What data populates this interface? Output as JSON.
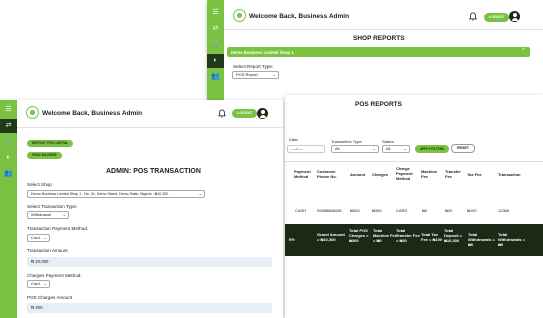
{
  "back_window": {
    "header": {
      "welcome": "Welcome Back, Business Admin",
      "logout": "LOGOUT"
    },
    "page_title": "SHOP REPORTS",
    "accordion": {
      "label": "Demo Business Limited Shop 1",
      "chevron": "^"
    },
    "report_type": {
      "label": "Select Report Type:",
      "value": "POS Report"
    },
    "pos_title": "POS REPORTS",
    "filters": {
      "date_label": "Date:",
      "date_value": "----/----",
      "tx_type_label": "Transaction Type:",
      "tx_type_value": "All",
      "status_label": "Status:",
      "status_value": "All",
      "apply_label": "APPLY FILTERS",
      "reset_label": "RESET"
    },
    "table": {
      "columns": [
        "Payment Method",
        "Customer Phone No.",
        "Amount",
        "Charges",
        "Charge Payment Method",
        "Machine Fee",
        "Transfer Fee",
        "Tax Fee",
        "Transaction"
      ],
      "row": [
        "CASH",
        "09958888438",
        "₦300",
        "₦300",
        "CARD",
        "₦0",
        "₦20",
        "₦100",
        "12366"
      ],
      "footer": [
        "RY:",
        "Grand Amount = ₦10,300",
        "Total POS Charges = ₦300",
        "Total Machine Fee = ₦0",
        "Total Transfer Fee = ₦20",
        "Total Tax Fee = ₦100",
        "Total Deposit = ₦10,300",
        "Total Withdrawals = ₦0",
        "Total Withdrawals = ₦0"
      ]
    }
  },
  "front_window": {
    "header": {
      "welcome": "Welcome Back, Business Admin",
      "logout": "LOGOUT"
    },
    "buttons": {
      "deposit": "DEPOSIT POS CAPITAL",
      "fund": "FUND MACHINE"
    },
    "page_title": "ADMIN: POS TRANSACTION",
    "select_shop": {
      "label": "Select Shop",
      "value": "Demo Business Limited Shop 1 - No. 01, Demo Street, Demo State, Nigeria - ₦10,300"
    },
    "tx_type": {
      "label": "Select Transaction Type:",
      "value": "Withdrawal"
    },
    "payment_method": {
      "label": "Transaction Payment Method:",
      "value": "Card"
    },
    "amount": {
      "label": "Transaction Amount",
      "value": "₦ 10,000"
    },
    "charges_method": {
      "label": "Charges Payment Method:",
      "value": "Card"
    },
    "charges_amount": {
      "label": "POS Charges Amount",
      "value": "₦ 300"
    }
  },
  "icons": [
    "menu-icon",
    "transfer-icon",
    "cart-icon",
    "palette-icon",
    "users-icon",
    "bell-icon",
    "avatar-icon"
  ],
  "colors": {
    "accent": "#7cc242",
    "dark": "#1f3a1a",
    "footer_bg": "#1b2a17",
    "field_bg": "#e8eef8"
  }
}
